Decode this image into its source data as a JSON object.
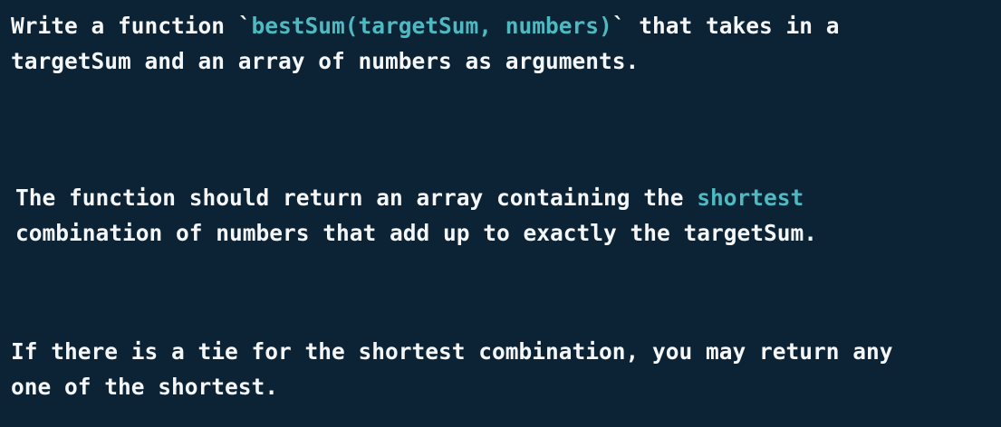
{
  "paragraph1": {
    "line1_pre": "Write a function `",
    "line1_code": "bestSum(targetSum, numbers)",
    "line1_post": "` that takes in a",
    "line2": "targetSum and an array of numbers as arguments."
  },
  "paragraph2": {
    "line1_pre": "The function should return an array containing the ",
    "line1_highlight": "shortest",
    "line2": "combination of numbers that add up to exactly the targetSum."
  },
  "paragraph3": {
    "line1": "If there is a tie for the shortest combination, you may return any",
    "line2": "one of the shortest."
  },
  "colors": {
    "background": "#0b2334",
    "text": "#f4f6f7",
    "highlight": "#4fb9c2"
  }
}
